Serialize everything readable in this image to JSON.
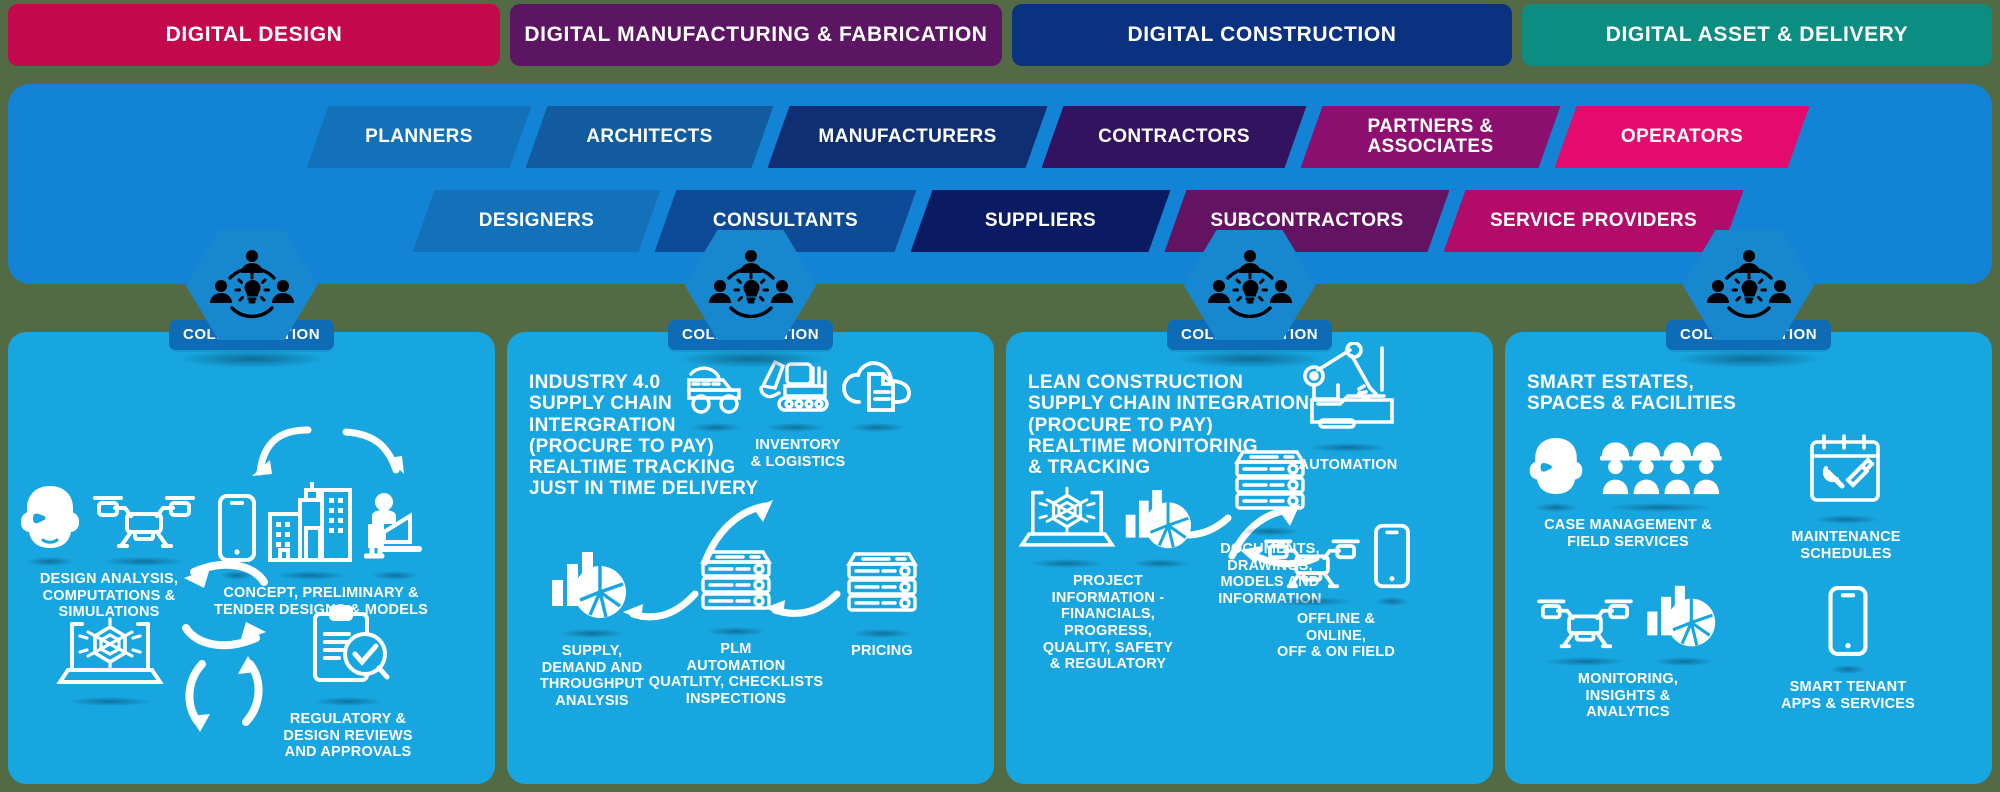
{
  "banners": [
    {
      "label": "DIGITAL DESIGN",
      "color": "#c3084c"
    },
    {
      "label": "DIGITAL MANUFACTURING & FABRICATION",
      "color": "#5c1563"
    },
    {
      "label": "DIGITAL CONSTRUCTION",
      "color": "#0b3281"
    },
    {
      "label": "DIGITAL ASSET & DELIVERY",
      "color": "#0b8d81"
    }
  ],
  "band": {
    "background": "#1383d6",
    "row1": [
      {
        "label": "PLANNERS",
        "color": "#1271b8"
      },
      {
        "label": "ARCHITECTS",
        "color": "#125b9e"
      },
      {
        "label": "MANUFACTURERS",
        "color": "#102f72"
      },
      {
        "label": "CONTRACTORS",
        "color": "#331360"
      },
      {
        "label": "PARTNERS &\nASSOCIATES",
        "color": "#8d1070"
      },
      {
        "label": "OPERATORS",
        "color": "#e50a6d"
      }
    ],
    "row2": [
      {
        "label": "DESIGNERS",
        "color": "#1271b8"
      },
      {
        "label": "CONSULTANTS",
        "color": "#0d4b96"
      },
      {
        "label": "SUPPLIERS",
        "color": "#0a1b63"
      },
      {
        "label": "SUBCONTRACTORS",
        "color": "#641363"
      },
      {
        "label": "SERVICE PROVIDERS",
        "color": "#b30b6a"
      }
    ]
  },
  "collaboration_label": "COLLABORATION",
  "panels": [
    {
      "name": "digital-design",
      "heading": "",
      "nodes": [
        {
          "caption": "DESIGN ANALYSIS,\nCOMPUTATIONS &\nSIMULATIONS",
          "icons": [
            "vr-headset-icon",
            "drone-icon"
          ]
        },
        {
          "caption": "CONCEPT, PRELIMINARY &\nTENDER DESIGNS & MODELS",
          "icons": [
            "mobile-phone-icon",
            "buildings-icon",
            "person-at-laptop-icon"
          ]
        },
        {
          "caption": "",
          "icons": [
            "laptop-atom-icon"
          ]
        },
        {
          "caption": "REGULATORY &\nDESIGN REVIEWS\nAND APPROVALS",
          "icons": [
            "clipboard-check-icon"
          ]
        }
      ]
    },
    {
      "name": "digital-manufacturing",
      "heading": "INDUSTRY 4.0\nSUPPLY CHAIN\nINTERGRATION\n(PROCURE TO PAY)\nREALTIME TRACKING\nJUST IN TIME DELIVERY",
      "nodes": [
        {
          "caption": "INVENTORY\n& LOGISTICS",
          "icons": [
            "dump-truck-icon",
            "excavator-icon",
            "cloud-document-icon"
          ]
        },
        {
          "caption": "SUPPLY,\nDEMAND AND\nTHROUGHPUT\nANALYSIS",
          "icons": [
            "bar-pie-chart-icon"
          ]
        },
        {
          "caption": "PLM\nAUTOMATION\nQUATLITY, CHECKLISTS\nINSPECTIONS",
          "icons": [
            "server-rack-icon"
          ]
        },
        {
          "caption": "PRICING",
          "icons": [
            "server-rack-icon"
          ]
        }
      ]
    },
    {
      "name": "digital-construction",
      "heading": "LEAN CONSTRUCTION\nSUPPLY CHAIN INTEGRATION\n(PROCURE TO PAY)\nREALTIME MONITORING\n& TRACKING",
      "nodes": [
        {
          "caption": "AUTOMATION",
          "icons": [
            "robot-arm-icon"
          ]
        },
        {
          "caption": "PROJECT\nINFORMATION -\nFINANCIALS,\nPROGRESS,\nQUALITY, SAFETY\n& REGULATORY",
          "icons": [
            "laptop-atom-icon",
            "bar-pie-chart-icon"
          ]
        },
        {
          "caption": "DOCUMENTS,\nDRAWINGS,\nMODELS AND\nINFORMATION",
          "icons": [
            "server-rack-icon"
          ]
        },
        {
          "caption": "OFFLINE &\nONLINE,\nOFF & ON FIELD",
          "icons": [
            "drone-icon",
            "mobile-phone-icon"
          ]
        }
      ]
    },
    {
      "name": "digital-asset-delivery",
      "heading": "SMART ESTATES,\nSPACES & FACILITIES",
      "nodes": [
        {
          "caption": "CASE MANAGEMENT &\nFIELD SERVICES",
          "icons": [
            "vr-headset-icon",
            "worker-group-icon"
          ]
        },
        {
          "caption": "MAINTENANCE\nSCHEDULES",
          "icons": [
            "calendar-tools-icon"
          ]
        },
        {
          "caption": "MONITORING,\nINSIGHTS &\nANALYTICS",
          "icons": [
            "drone-icon",
            "bar-pie-chart-icon"
          ]
        },
        {
          "caption": "SMART TENANT\nAPPS & SERVICES",
          "icons": [
            "mobile-phone-icon"
          ]
        }
      ]
    }
  ]
}
